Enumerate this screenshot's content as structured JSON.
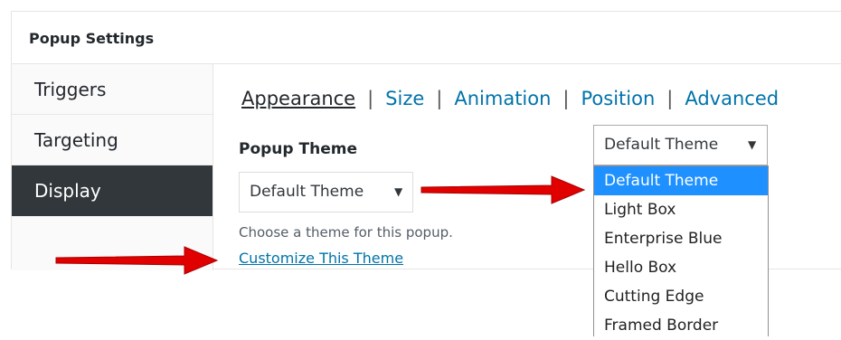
{
  "panel": {
    "title": "Popup Settings"
  },
  "sidebar": {
    "items": [
      {
        "label": "Triggers"
      },
      {
        "label": "Targeting"
      },
      {
        "label": "Display"
      }
    ]
  },
  "subnav": {
    "tabs": [
      {
        "label": "Appearance"
      },
      {
        "label": "Size"
      },
      {
        "label": "Animation"
      },
      {
        "label": "Position"
      },
      {
        "label": "Advanced"
      }
    ],
    "separator": "|"
  },
  "theme": {
    "label": "Popup Theme",
    "selected": "Default Theme",
    "description": "Choose a theme for this popup.",
    "customize_link": "Customize This Theme"
  },
  "dropdown": {
    "selected": "Default Theme",
    "options": [
      "Default Theme",
      "Light Box",
      "Enterprise Blue",
      "Hello Box",
      "Cutting Edge",
      "Framed Border"
    ]
  },
  "colors": {
    "link": "#0073aa",
    "active_sidebar_bg": "#32373c",
    "option_highlight": "#1e90ff",
    "annotation_arrow": "#e00000"
  },
  "icons": {
    "dropdown_caret": "▼"
  }
}
